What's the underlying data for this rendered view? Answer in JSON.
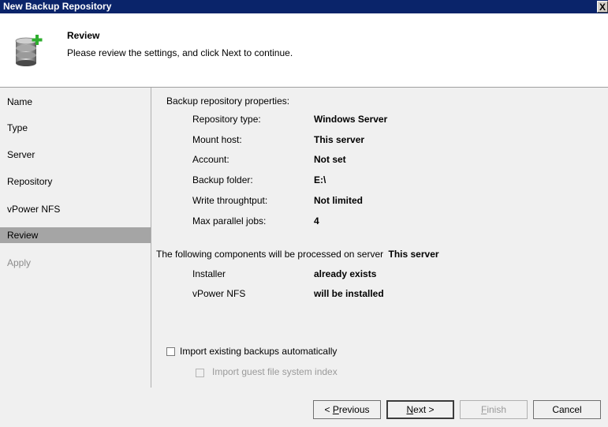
{
  "window": {
    "title": "New Backup Repository",
    "close_glyph": "X"
  },
  "header": {
    "title": "Review",
    "subtitle": "Please review the settings, and click Next to continue.",
    "icon": "database-add-icon"
  },
  "steps": [
    {
      "label": "Name",
      "state": "normal"
    },
    {
      "label": "Type",
      "state": "normal"
    },
    {
      "label": "Server",
      "state": "normal"
    },
    {
      "label": "Repository",
      "state": "normal"
    },
    {
      "label": "vPower NFS",
      "state": "normal"
    },
    {
      "label": "Review",
      "state": "active"
    },
    {
      "label": "Apply",
      "state": "disabled"
    }
  ],
  "properties": {
    "heading": "Backup repository properties:",
    "rows": [
      {
        "label": "Repository type:",
        "value": "Windows Server"
      },
      {
        "label": "Mount host:",
        "value": "This server"
      },
      {
        "label": "Account:",
        "value": "Not set"
      },
      {
        "label": "Backup folder:",
        "value": "E:\\"
      },
      {
        "label": "Write throughtput:",
        "value": "Not limited"
      },
      {
        "label": "Max parallel jobs:",
        "value": "4"
      }
    ]
  },
  "components": {
    "heading": "The following components will be processed on server",
    "server": "This server",
    "rows": [
      {
        "label": "Installer",
        "value": "already exists"
      },
      {
        "label": "vPower NFS",
        "value": "will be installed"
      }
    ]
  },
  "options": {
    "import_backups": {
      "label": "Import existing backups automatically",
      "checked": false
    },
    "import_index": {
      "label": "Import guest file system index",
      "checked": false,
      "enabled": false
    }
  },
  "buttons": {
    "previous": {
      "prefix": "< ",
      "accel": "P",
      "rest": "revious"
    },
    "next": {
      "accel": "N",
      "rest": "ext >"
    },
    "finish": {
      "accel": "F",
      "rest": "inish"
    },
    "cancel": "Cancel"
  },
  "colors": {
    "titlebar": "#0a246a",
    "active_step": "#a5a5a5",
    "panel": "#f0f0f0"
  }
}
